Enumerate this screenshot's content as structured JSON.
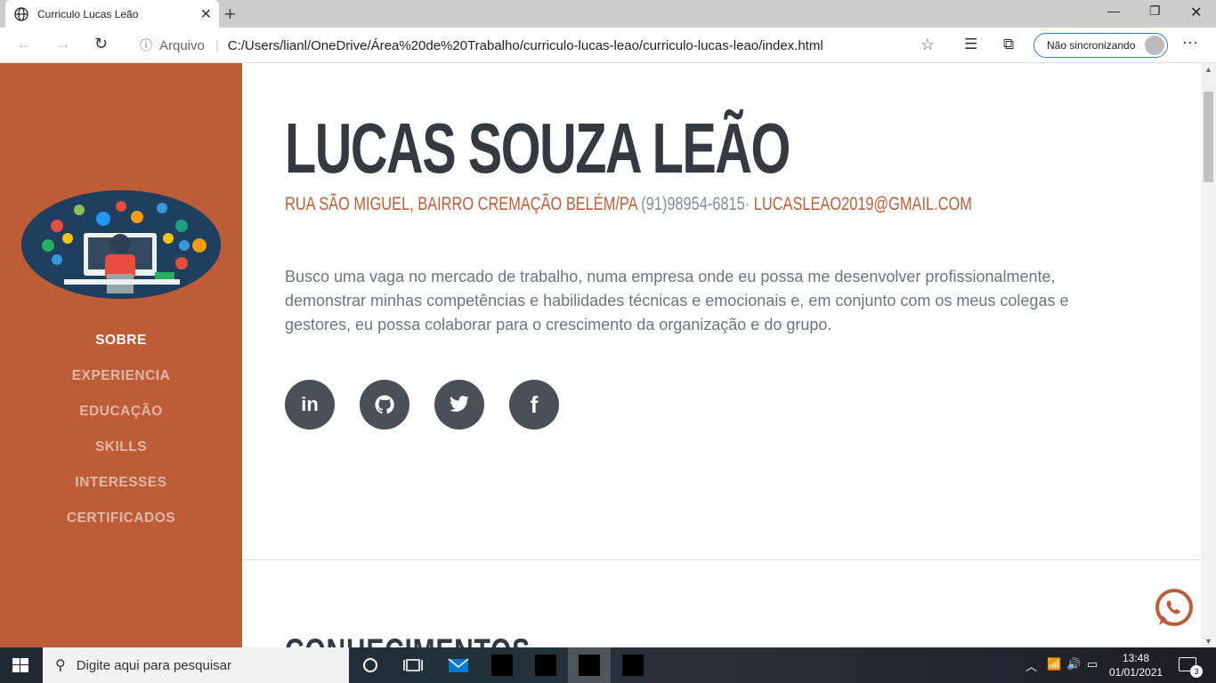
{
  "browser": {
    "tab_title": "Curriculo Lucas Leão",
    "new_tab": "+",
    "close_tab": "✕",
    "address_label": "Arquivo",
    "url": "C:/Users/lianl/OneDrive/Área%20de%20Trabalho/curriculo-lucas-leao/curriculo-lucas-leao/index.html",
    "sync_label": "Não sincronizando"
  },
  "sidebar": {
    "nav": [
      {
        "label": "SOBRE",
        "active": true
      },
      {
        "label": "EXPERIENCIA",
        "active": false
      },
      {
        "label": "EDUCAÇÃO",
        "active": false
      },
      {
        "label": "SKILLS",
        "active": false
      },
      {
        "label": "INTERESSES",
        "active": false
      },
      {
        "label": "CERTIFICADOS",
        "active": false
      }
    ]
  },
  "about": {
    "name": "LUCAS SOUZA LEÃO",
    "address": "RUA SÃO MIGUEL, BAIRRO CREMAÇÃO BELÉM/PA",
    "phone": " (91)98954-6815· ",
    "email": "LUCASLEAO2019@GMAIL.COM",
    "lead": "Busco uma vaga no mercado de trabalho, numa empresa onde eu possa me desenvolver profissionalmente, demonstrar minhas competências e habilidades técnicas e emocionais e, em conjunto com os meus colegas e gestores, eu possa colaborar para o crescimento da organização e do grupo.",
    "social": [
      "in",
      "github",
      "twitter",
      "f"
    ]
  },
  "next_section_title": "CONHECIMENTOS",
  "taskbar": {
    "search_placeholder": "Digite aqui para pesquisar",
    "time": "13:48",
    "date": "01/01/2021",
    "notifications": "3"
  },
  "colors": {
    "sidebar": "#bd5d38",
    "heading": "#343a40",
    "accent": "#bd5d38"
  }
}
